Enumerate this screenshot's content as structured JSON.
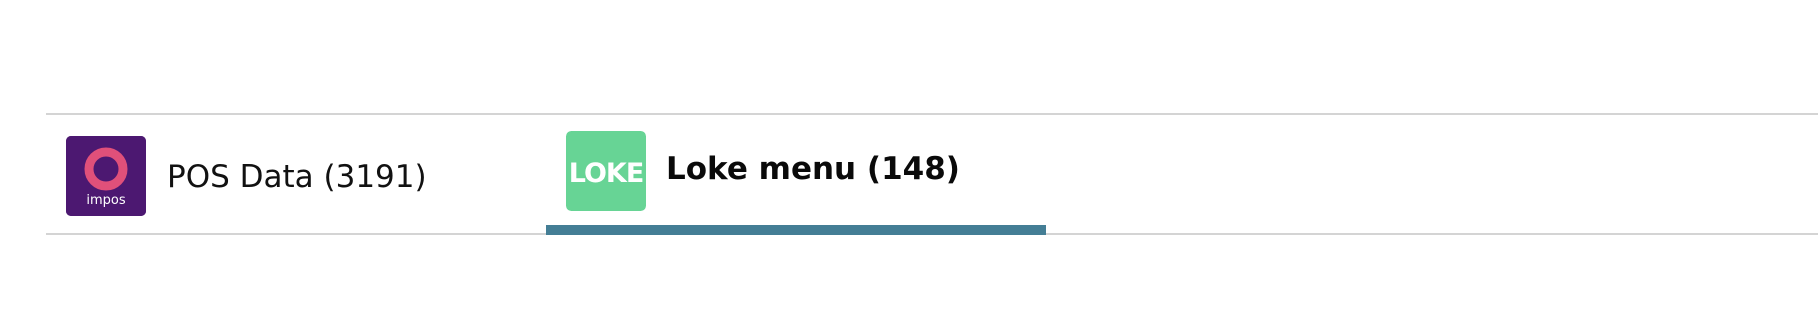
{
  "tabs": [
    {
      "id": "pos",
      "label": "POS Data (3191)",
      "logo_text": "impos",
      "icon": "impos-logo-icon",
      "active": false,
      "colors": {
        "bg": "#4c1871",
        "ring": "#e0507a",
        "text": "#ffffff"
      }
    },
    {
      "id": "loke",
      "label": "Loke menu (148)",
      "logo_text": "LOKE",
      "icon": "loke-logo-icon",
      "active": true,
      "colors": {
        "bg": "#67d495",
        "text": "#ffffff"
      }
    }
  ],
  "colors": {
    "active_indicator": "#447e95",
    "border": "#d4d4d4"
  }
}
